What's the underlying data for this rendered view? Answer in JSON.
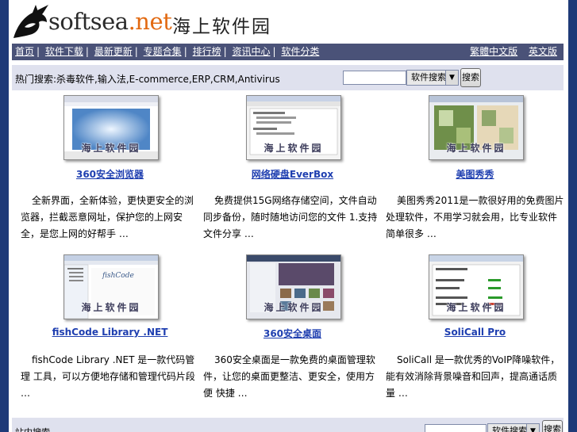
{
  "header": {
    "site_name_main": "softsea",
    "site_name_tld": ".net",
    "site_name_cn": "海上软件园"
  },
  "nav": {
    "left_items": [
      "首页",
      "软件下载",
      "最新更新",
      "专题合集",
      "排行榜",
      "资讯中心",
      "软件分类"
    ],
    "right_items": [
      "繁體中文版",
      "英文版"
    ]
  },
  "search": {
    "hot_label": "热门搜索:",
    "hot_terms": "杀毒软件,输入法,E-commerce,ERP,CRM,Antivirus",
    "input_value": "",
    "select_value": "软件搜索",
    "button_label": "搜索"
  },
  "cards": [
    {
      "title": "360安全浏览器",
      "desc": "全新界面，全新体验，更快更安全的浏览器，拦截恶意网址，保护您的上网安全，是您上网的好帮手 …",
      "watermark": "海上软件园"
    },
    {
      "title": "网络硬盘EverBox",
      "desc": "免费提供15G网络存储空间，文件自动同步备份，随时随地访问您的文件 1.支持文件分享 …",
      "watermark": "海上软件园"
    },
    {
      "title": "美图秀秀",
      "desc": "美图秀秀2011是一款很好用的免费图片处理软件，不用学习就会用，比专业软件简单很多 …",
      "watermark": "海上软件园"
    },
    {
      "title": "fishCode Library .NET",
      "desc": "fishCode Library .NET 是一款代码管理 工具，可以方便地存储和管理代码片段 …",
      "watermark": "海上软件园"
    },
    {
      "title": "360安全桌面",
      "desc": "360安全桌面是一款免费的桌面管理软件，让您的桌面更整洁、更安全，使用方便 快捷 …",
      "watermark": "海上软件园"
    },
    {
      "title": "SoliCall Pro",
      "desc": "SoliCall 是一款优秀的VoIP降噪软件，能有效消除背景噪音和回声，提高通话质量 …",
      "watermark": "海上软件园"
    }
  ],
  "footer": {
    "label": "站内搜索",
    "select_value": "软件搜索",
    "button_label": "搜索"
  },
  "colors": {
    "frame": "#1e3a78",
    "navbar": "#4a5278",
    "searchbar": "#dfe1ee",
    "link": "#1f3fb0",
    "accent": "#e26a12"
  }
}
